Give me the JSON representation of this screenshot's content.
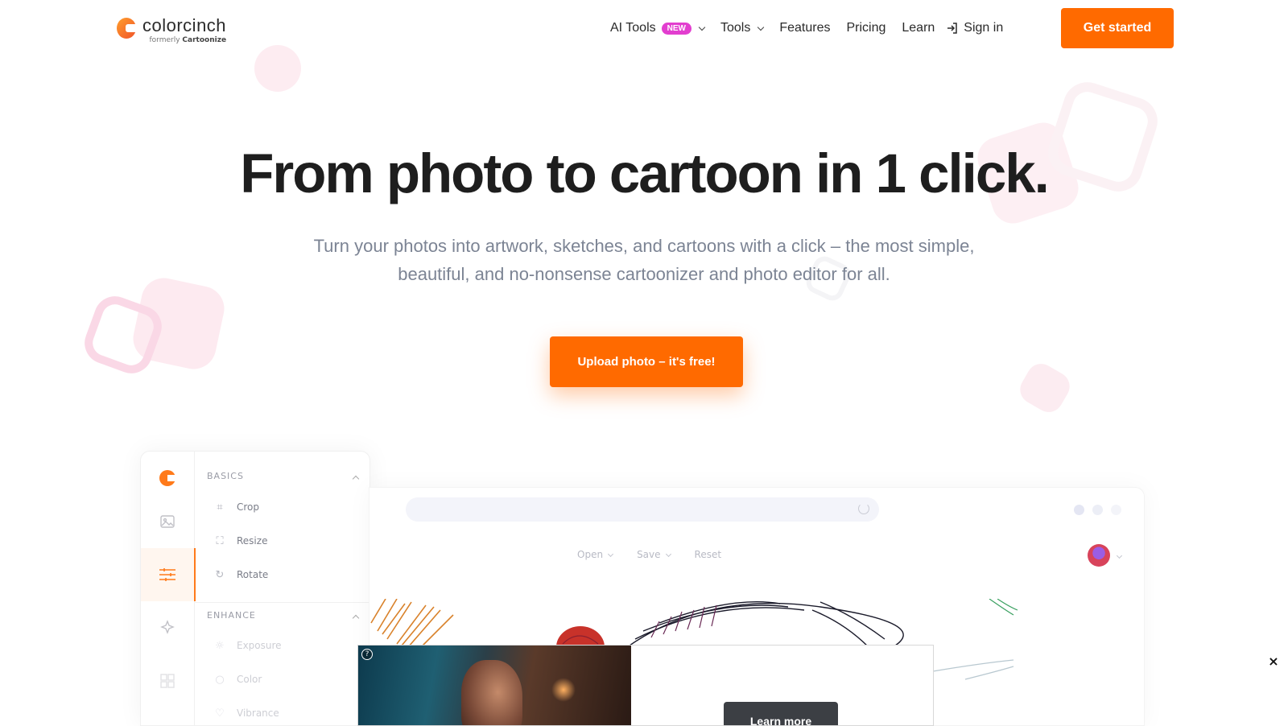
{
  "brand": {
    "name": "colorcinch",
    "sub_prefix": "formerly",
    "sub_name": "Cartoonize",
    "accent": "#ff6a00"
  },
  "nav": {
    "ai_tools": "AI Tools",
    "new_badge": "NEW",
    "tools": "Tools",
    "features": "Features",
    "pricing": "Pricing",
    "learn": "Learn",
    "sign_in": "Sign in",
    "get_started": "Get started"
  },
  "hero": {
    "title": "From photo to cartoon in 1 click.",
    "subtitle": "Turn your photos into artwork, sketches, and cartoons with a click – the most simple, beautiful, and no-nonsense cartoonizer and photo editor for all.",
    "cta": "Upload photo – it's free!"
  },
  "editor": {
    "sections": {
      "basics": "BASICS",
      "enhance": "ENHANCE"
    },
    "basics_tools": [
      "Crop",
      "Resize",
      "Rotate"
    ],
    "enhance_tools": [
      "Exposure",
      "Color",
      "Vibrance"
    ],
    "toolbar": {
      "open": "Open",
      "save": "Save",
      "reset": "Reset"
    },
    "rail_icons": [
      "colorcinch-logo-icon",
      "image-icon",
      "sliders-icon",
      "sparkle-icon",
      "grid-icon"
    ]
  },
  "ad": {
    "cta": "Learn more",
    "info_icon": "?",
    "close_icon": "×"
  }
}
